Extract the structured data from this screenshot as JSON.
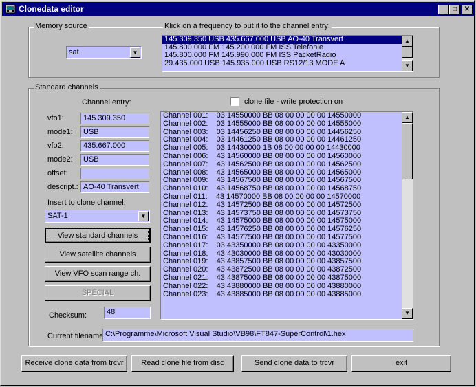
{
  "window": {
    "title": "Clonedata editor",
    "min_glyph": "_",
    "max_glyph": "□",
    "close_glyph": "✕"
  },
  "memory_source": {
    "label": "Memory source",
    "selected": "sat",
    "freq_hint": "Klick on a frequency to put it to the channel entry:",
    "freq_items": [
      "145.309.350 USB 435.667.000 USB AO-40 Transvert",
      "145.800.000 FM 145.200.000 FM ISS Telefonie",
      "145.800.000 FM 145.990.000 FM ISS PacketRadio",
      "29.435.000 USB 145.935.000 USB RS12/13 MODE A"
    ]
  },
  "standard": {
    "label": "Standard channels",
    "channel_entry_label": "Channel entry:",
    "clone_checkbox_label": "clone file - write protection on",
    "clone_checked": false,
    "fields": {
      "vfo1_label": "vfo1:",
      "vfo1": "145.309.350",
      "mode1_label": "mode1:",
      "mode1": "USB",
      "vfo2_label": "vfo2:",
      "vfo2": "435.667.000",
      "mode2_label": "mode2:",
      "mode2": "USB",
      "offset_label": "offset:",
      "offset": "",
      "descript_label": "descript.:",
      "descript": "AO-40 Transvert"
    },
    "insert_label": "Insert to clone channel:",
    "insert_selected": "SAT-1",
    "buttons": {
      "view_standard": "View standard channels",
      "view_satellite": "View satellite channels",
      "view_vfo": "View VFO scan range ch.",
      "special": "SPECIAL"
    },
    "checksum_label": "Checksum:",
    "checksum": "48",
    "channels": [
      "Channel 001:    03 14550000 BB 08 00 00 00 00 14550000",
      "Channel 002:    03 14555000 BB 08 00 00 00 00 14555000",
      "Channel 003:    03 14456250 BB 08 00 00 00 00 14456250",
      "Channel 004:    03 14461250 BB 08 00 00 00 00 14461250",
      "Channel 005:    03 14430000 1B 08 00 00 00 00 14430000",
      "Channel 006:    43 14560000 BB 08 00 00 00 00 14560000",
      "Channel 007:    43 14562500 BB 08 00 00 00 00 14562500",
      "Channel 008:    43 14565000 BB 08 00 00 00 00 14565000",
      "Channel 009:    43 14567500 BB 08 00 00 00 00 14567500",
      "Channel 010:    43 14568750 BB 08 00 00 00 00 14568750",
      "Channel 011:    43 14570000 BB 08 00 00 00 00 14570000",
      "Channel 012:    43 14572500 BB 08 00 00 00 00 14572500",
      "Channel 013:    43 14573750 BB 08 00 00 00 00 14573750",
      "Channel 014:    43 14575000 BB 08 00 00 00 00 14575000",
      "Channel 015:    43 14576250 BB 08 00 00 00 00 14576250",
      "Channel 016:    43 14577500 BB 08 00 00 00 00 14577500",
      "Channel 017:    03 43350000 BB 08 00 00 00 00 43350000",
      "Channel 018:    43 43030000 BB 08 00 00 00 00 43030000",
      "Channel 019:    43 43857500 BB 08 00 00 00 00 43857500",
      "Channel 020:    43 43872500 BB 08 00 00 00 00 43872500",
      "Channel 021:    43 43875000 BB 08 00 00 00 00 43875000",
      "Channel 022:    43 43880000 BB 08 00 00 00 00 43880000",
      "Channel 023:    43 43885000 BB 08 00 00 00 00 43885000"
    ]
  },
  "filename": {
    "label": "Current filename:",
    "value": "C:\\Programme\\Microsoft Visual Studio\\VB98\\FT847-SuperControl\\1.hex"
  },
  "bottom_buttons": {
    "receive": "Receive clone data from trcvr",
    "read": "Read clone file from disc",
    "send": "Send clone data to trcvr",
    "exit": "exit"
  },
  "icons": {
    "scroll_up": "▲",
    "scroll_down": "▼",
    "combo_arrow": "▼"
  }
}
